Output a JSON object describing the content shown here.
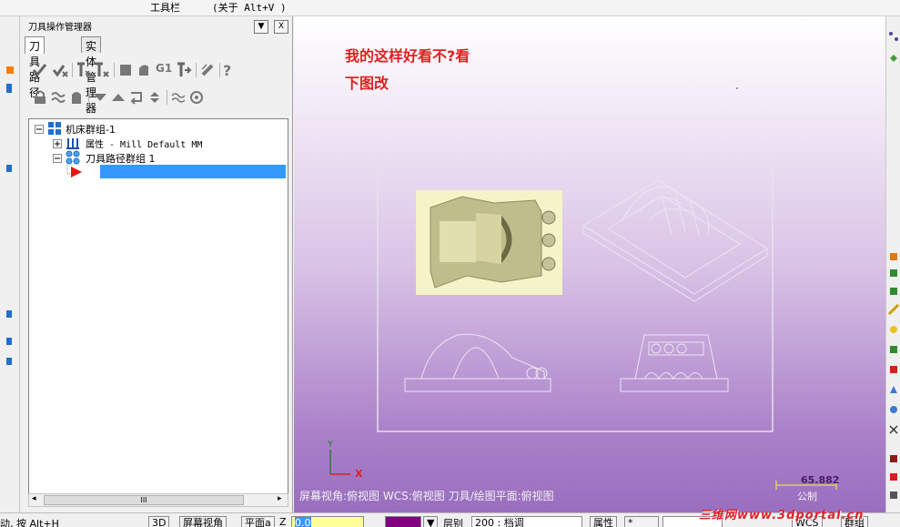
{
  "toolbar": {
    "label": "工具栏",
    "about": "(关于 Alt+V )"
  },
  "manager": {
    "title": "刀具操作管理器",
    "pin_button": "▼",
    "close_button": "X",
    "tabs": [
      {
        "label": "刀具路径"
      },
      {
        "label": "实体管理器"
      }
    ],
    "scroll_thumb": "III"
  },
  "tree": {
    "machine_group": "机床群组-1",
    "properties": "属性 - Mill Default MM",
    "toolpath_group": "刀具路径群组 1"
  },
  "graphics": {
    "note_line1": "我的这样好看不?看",
    "note_line2": "下图改",
    "axis_y": "Y",
    "axis_x": "X",
    "status": "屏幕视角:俯视图    WCS:俯视图    刀具/绘图平面:俯视图",
    "scale_value": "65.882",
    "scale_unit": "公制"
  },
  "statusbar": {
    "hint": "动, 按 Alt+H",
    "btn_3d": "3D",
    "btn_screen_view": "屏幕视角",
    "btn_plane": "平面a",
    "z_label": "Z",
    "z_value": "0.0",
    "layer_label": "层别",
    "layer_value": "200 : 档调",
    "props": "属性",
    "star": "*",
    "wcs": "WCS",
    "group": "群组"
  },
  "watermark": "三维网www.3dportal.cn",
  "colors": {
    "accent_red": "#e02020",
    "selection_blue": "#3399ff",
    "gfx_bottom": "#9a6ec0"
  }
}
